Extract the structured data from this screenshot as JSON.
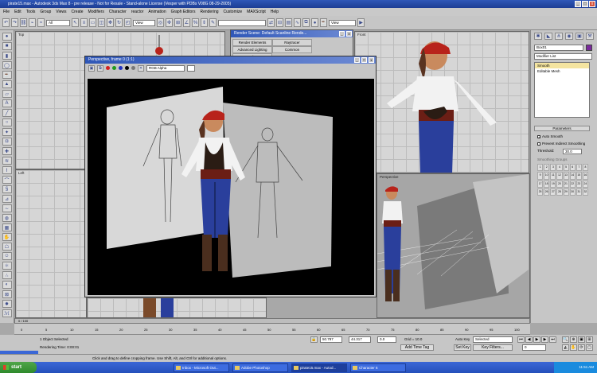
{
  "app": {
    "title": "pirate15.max - Autodesk 3ds Max 8 - pre release - Not for Resale - Stand-alone License (Vesper with PDBs V08G 08-29-2005)",
    "window_controls": [
      "_",
      "□",
      "x"
    ]
  },
  "menu": [
    "File",
    "Edit",
    "Tools",
    "Group",
    "Views",
    "Create",
    "Modifiers",
    "Character",
    "reactor",
    "Animation",
    "Graph Editors",
    "Rendering",
    "Customize",
    "MAXScript",
    "Help"
  ],
  "toolbar": {
    "selection_filter": "All",
    "reference_coord": "View",
    "named_selection": "",
    "view_dropdown": "View"
  },
  "viewports": {
    "top": "Top",
    "front": "Front",
    "left": "Left",
    "perspective": "Perspective"
  },
  "command_panel": {
    "object_name": "Box01",
    "modifier_list": "Modifier List",
    "stack": [
      "Smooth",
      "Editable Mesh"
    ],
    "parameters_title": "Parameters",
    "auto_smooth": "Auto Smooth",
    "prevent_indirect": "Prevent Indirect Smoothing",
    "threshold_label": "Threshold:",
    "threshold_value": "30.0",
    "smoothing_groups": "Smoothing Groups",
    "groups": [
      "1",
      "2",
      "3",
      "4",
      "5",
      "6",
      "7",
      "8",
      "9",
      "10",
      "11",
      "12",
      "13",
      "14",
      "15",
      "16",
      "17",
      "18",
      "19",
      "20",
      "21",
      "22",
      "23",
      "24",
      "25",
      "26",
      "27",
      "28",
      "29",
      "30",
      "31",
      "32"
    ]
  },
  "render_dialog": {
    "title": "Render Scene: Default Scanline Rende...",
    "tabs": [
      "Render Elements",
      "Raytracer",
      "Advanced Lighting",
      "Common",
      "Renderer"
    ]
  },
  "frame_buffer": {
    "title": "Perspective, frame 0 (1:1)",
    "channel": "RGB Alpha"
  },
  "timeline": {
    "frame": "0 / 100",
    "ticks": [
      "0",
      "5",
      "10",
      "15",
      "20",
      "25",
      "30",
      "35",
      "40",
      "45",
      "50",
      "55",
      "60",
      "65",
      "70",
      "75",
      "80",
      "85",
      "90",
      "95",
      "100"
    ]
  },
  "status": {
    "selected": "1 Object Selected",
    "render_time": "Rendering Time: 0:00:01",
    "hint": "Click and drag to define cropping frame. Use Shift, Alt, and Ctrl for additional options.",
    "x_value": "50.797",
    "y_value": "44.317",
    "z_value": "0.0",
    "grid": "Grid = 10.0",
    "add_time_tag": "Add Time Tag",
    "auto_key": "Auto Key",
    "set_key": "Set Key",
    "key_mode": "Selected",
    "key_filters": "Key Filters...",
    "frame_field": "0",
    "maxscript_tab": "Maxscr..."
  },
  "taskbar": {
    "start": "start",
    "tasks": [
      "Inbox - Microsoft Out...",
      "Adobe Photoshop",
      "pirate15.max - Autod...",
      "Character 6"
    ],
    "clock": "11:51 AM"
  },
  "colors": {
    "title_blue": "#1c3d94",
    "ui_gray": "#c6c6c6",
    "taskbar_blue": "#2550bb",
    "start_green": "#2f8a2c",
    "pirate_shirt": "#f2f2f2",
    "pirate_pants": "#2a3f9c",
    "pirate_bandana": "#b8231b"
  }
}
